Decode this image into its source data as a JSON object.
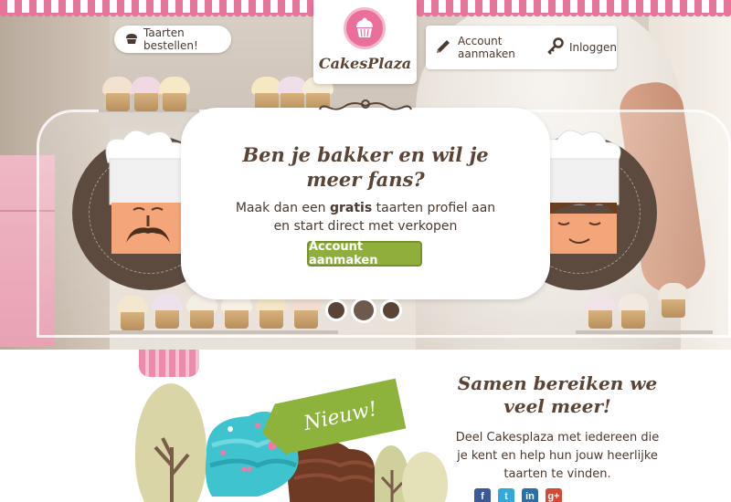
{
  "header": {
    "order_label": "Taarten bestellen!",
    "logo_text": "CakesPlaza",
    "account_label": "Account aanmaken",
    "login_label": "Inloggen"
  },
  "hero": {
    "title_line1": "Ben je bakker en wil je",
    "title_line2": "meer fans?",
    "text_before": "Maak dan een ",
    "text_bold": "gratis",
    "text_after": " taarten profiel aan",
    "text_line2": "en start direct met verkopen",
    "cta_label": "Account aanmaken",
    "slides": 3,
    "active_slide": 2
  },
  "promo": {
    "badge": "Nieuw!",
    "title_line1": "Samen bereiken we",
    "title_line2": "veel meer!",
    "text_line1": "Deel Cakesplaza met iedereen die",
    "text_line2": "je kent en help hun jouw heerlijke",
    "text_line3": "taarten te vinden."
  },
  "socials": [
    {
      "icon": "facebook-icon",
      "glyph": "f",
      "color": "#3b5998"
    },
    {
      "icon": "twitter-icon",
      "glyph": "t",
      "color": "#33a8dd"
    },
    {
      "icon": "linkedin-icon",
      "glyph": "in",
      "color": "#2a6fa8"
    },
    {
      "icon": "google-plus-icon",
      "glyph": "g+",
      "color": "#d34836"
    }
  ],
  "colors": {
    "brand_pink": "#ea6f9c",
    "brown": "#5a4436",
    "green": "#8fae3b"
  }
}
